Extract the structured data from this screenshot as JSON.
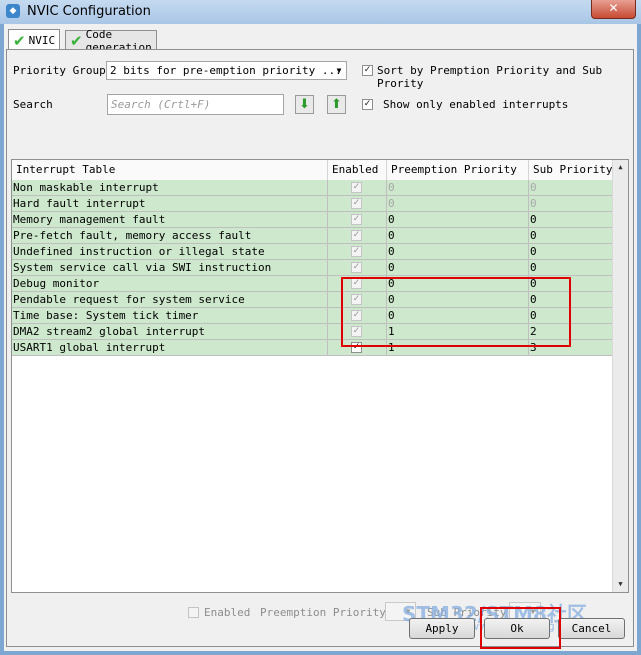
{
  "window": {
    "title": "NVIC Configuration",
    "close_glyph": "✕"
  },
  "tabs": [
    {
      "label": "NVIC",
      "active": true,
      "icon": "green-check-icon"
    },
    {
      "label": "Code generation",
      "active": false,
      "icon": "green-check-icon"
    }
  ],
  "controls": {
    "priority_group_label": "Priority Group",
    "priority_group_value": "2 bits for pre-emption priority ...",
    "sort_label": "Sort by Premption Priority and Sub Prority",
    "sort_checked": true,
    "search_label": "Search",
    "search_placeholder": "Search (Crtl+F)",
    "show_enabled_label": "Show only enabled interrupts",
    "show_enabled_checked": true
  },
  "table": {
    "columns": [
      "Interrupt Table",
      "Enabled",
      "Preemption Priority",
      "Sub Priority"
    ],
    "rows": [
      {
        "name": "Non maskable interrupt",
        "enabled": true,
        "preemption": "0",
        "sub": "0",
        "dim": true
      },
      {
        "name": "Hard fault interrupt",
        "enabled": true,
        "preemption": "0",
        "sub": "0",
        "dim": true
      },
      {
        "name": "Memory management fault",
        "enabled": true,
        "preemption": "0",
        "sub": "0",
        "dim": false
      },
      {
        "name": "Pre-fetch fault, memory access fault",
        "enabled": true,
        "preemption": "0",
        "sub": "0",
        "dim": false
      },
      {
        "name": "Undefined instruction or illegal state",
        "enabled": true,
        "preemption": "0",
        "sub": "0",
        "dim": false
      },
      {
        "name": "System service call via SWI instruction",
        "enabled": true,
        "preemption": "0",
        "sub": "0",
        "dim": false
      },
      {
        "name": "Debug monitor",
        "enabled": true,
        "preemption": "0",
        "sub": "0",
        "dim": false
      },
      {
        "name": "Pendable request for system service",
        "enabled": true,
        "preemption": "0",
        "sub": "0",
        "dim": false
      },
      {
        "name": "Time base: System tick timer",
        "enabled": true,
        "preemption": "0",
        "sub": "0",
        "dim": false
      },
      {
        "name": "DMA2 stream2 global interrupt",
        "enabled": true,
        "preemption": "1",
        "sub": "2",
        "dim": false
      },
      {
        "name": "USART1 global interrupt",
        "enabled": true,
        "preemption": "1",
        "sub": "3",
        "dim": false,
        "editable": true
      }
    ]
  },
  "bottom": {
    "enabled_label": "Enabled",
    "preemption_label": "Preemption Priority",
    "sub_label": "Sub Priority"
  },
  "buttons": {
    "apply": "Apply",
    "ok": "Ok",
    "cancel": "Cancel"
  },
  "watermark": {
    "main": "STM32/STM8社区",
    "sub": "www.stmcu.org"
  },
  "colors": {
    "row_bg": "#cde8cd",
    "highlight": "#e00000",
    "accent_check": "#38b238"
  }
}
